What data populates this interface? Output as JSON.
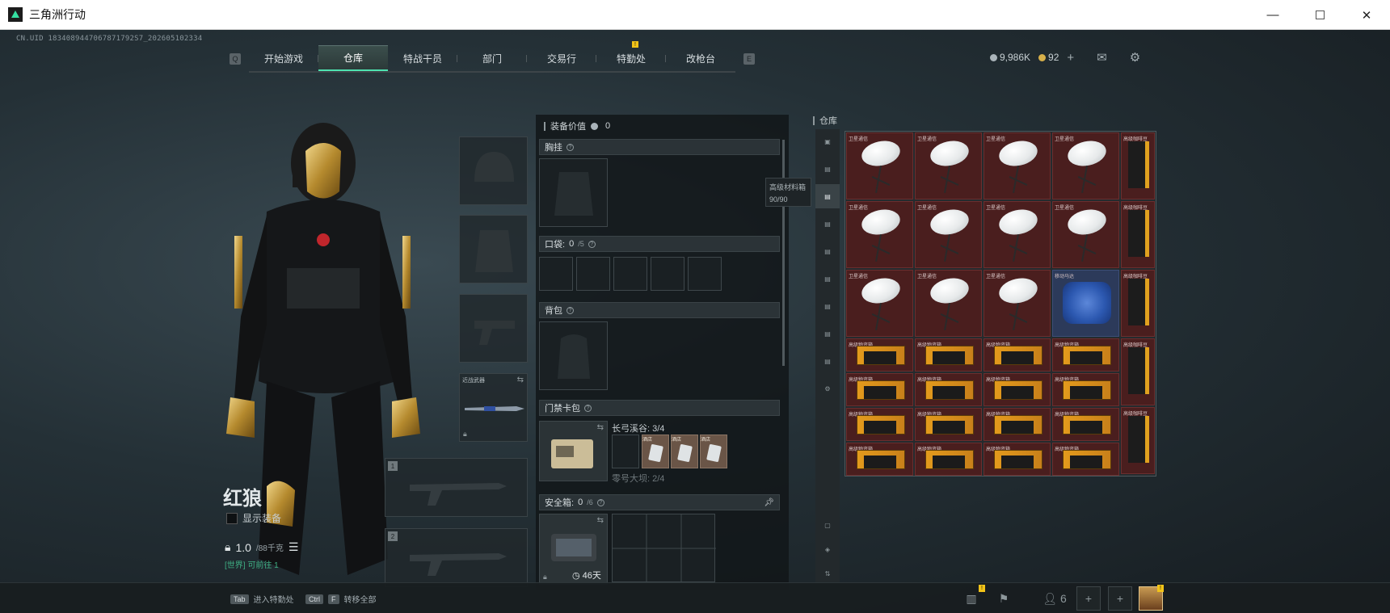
{
  "window": {
    "title": "三角洲行动",
    "minimize": "—",
    "close": "✕"
  },
  "uid": "CN.UID 1834089447067871792S7_202605102334",
  "nav": {
    "left_key": "Q",
    "right_key": "E",
    "tabs": [
      {
        "label": "开始游戏"
      },
      {
        "label": "仓库",
        "active": true
      },
      {
        "label": "特战干员"
      },
      {
        "label": "部门"
      },
      {
        "label": "交易行"
      },
      {
        "label": "特勤处",
        "badge": "!"
      },
      {
        "label": "改枪台"
      }
    ]
  },
  "currency": {
    "silver": "9,986K",
    "gold": "92",
    "add": "+"
  },
  "operator": {
    "name": "红狼",
    "show_equipment": "显示装备",
    "weight": "1.0",
    "weight_max": "/88千克",
    "status": "[世界] 可前往 1"
  },
  "equipment": {
    "value_label": "装备价值",
    "value": "0",
    "sections": {
      "chest": {
        "title": "胸挂"
      },
      "pocket": {
        "title": "口袋:",
        "count": "0",
        "max": "/5"
      },
      "backpack": {
        "title": "背包"
      },
      "keycard": {
        "title": "门禁卡包"
      },
      "safebox": {
        "title": "安全箱:",
        "count": "0",
        "max": "/6",
        "timer": "46天"
      }
    },
    "keycard_rows": [
      {
        "label": "长弓溪谷: 3/4"
      },
      {
        "label": "零号大坝: 2/4"
      }
    ],
    "keycard_items": [
      "酒店",
      "酒店",
      "酒店"
    ]
  },
  "slots": {
    "melee_label": "近战武器",
    "primary_num": "1",
    "secondary_num": "2"
  },
  "tooltip": {
    "name": "高级材料箱",
    "count": "90/90"
  },
  "warehouse": {
    "title": "仓库",
    "item_names": {
      "dish": "卫星通信",
      "motor": "移动马达",
      "box": "高级物资箱",
      "bag": "高级咖啡豆"
    }
  },
  "bottom": {
    "hint1_key": "Tab",
    "hint1": "进入特勤处",
    "hint2_key": "Ctrl",
    "hint2_key2": "F",
    "hint2": "转移全部",
    "friends": "6"
  }
}
